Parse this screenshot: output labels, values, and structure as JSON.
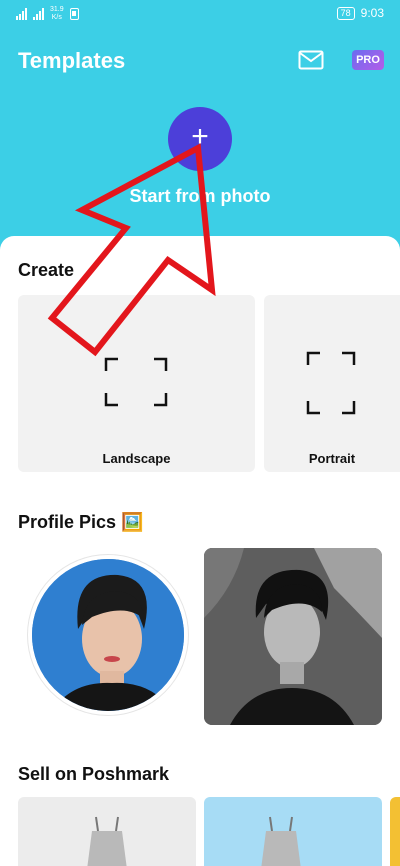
{
  "status_bar": {
    "net_speed_value": "31.9",
    "net_speed_unit": "K/s",
    "battery": "78",
    "time": "9:03"
  },
  "header": {
    "title": "Templates",
    "pro_label": "PRO"
  },
  "start_from_photo": {
    "plus": "+",
    "label": "Start from photo"
  },
  "create": {
    "title": "Create",
    "cards": [
      {
        "label": "Landscape"
      },
      {
        "label": "Portrait"
      }
    ]
  },
  "profile_pics": {
    "title": "Profile Pics 🖼️"
  },
  "sell": {
    "title": "Sell on Poshmark"
  },
  "colors": {
    "accent": "#3ccfe6",
    "fab": "#4c3fd9",
    "annotation_arrow": "#e3161c"
  }
}
